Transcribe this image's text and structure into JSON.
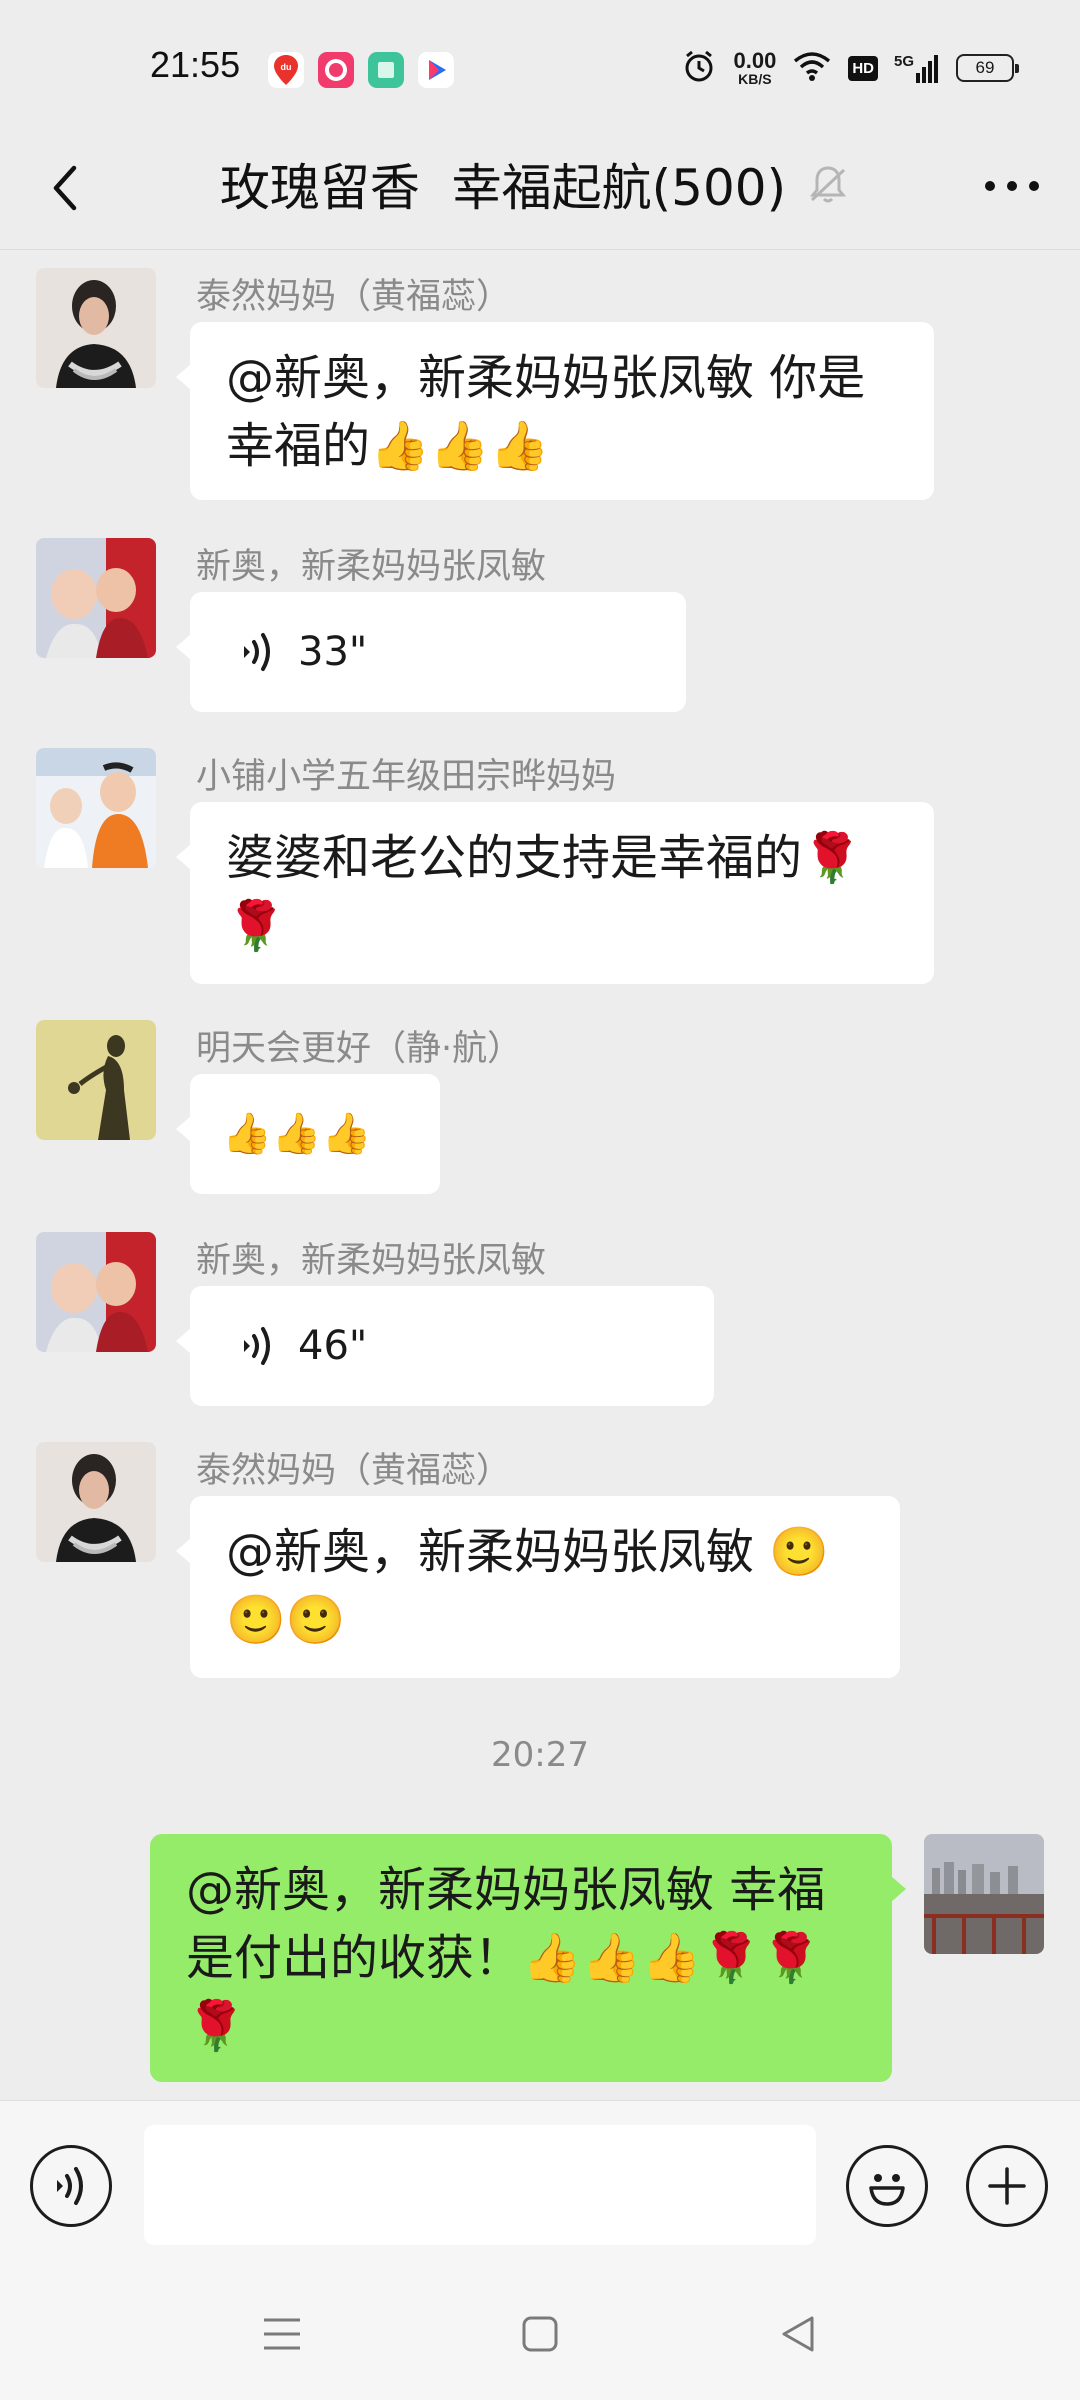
{
  "status": {
    "time": "21:55",
    "net_speed_value": "0.00",
    "net_speed_unit": "KB/S",
    "hd": "HD",
    "network": "5G",
    "battery": "69"
  },
  "header": {
    "title": "玫瑰留香  幸福起航(500)"
  },
  "messages": [
    {
      "sender": "泰然妈妈（黄福蕊）",
      "text": "@新奥，新柔妈妈张凤敏  你是幸福的👍👍👍"
    },
    {
      "sender": "新奥，新柔妈妈张凤敏",
      "duration": "33\""
    },
    {
      "sender": "小铺小学五年级田宗晔妈妈",
      "text": "婆婆和老公的支持是幸福的🌹🌹"
    },
    {
      "sender": "明天会更好（静·航）",
      "text": "👍👍👍"
    },
    {
      "sender": "新奥，新柔妈妈张凤敏",
      "duration": "46\""
    },
    {
      "sender": "泰然妈妈（黄福蕊）",
      "text": "@新奥，新柔妈妈张凤敏 🙂🙂🙂"
    }
  ],
  "timestamp": "20:27",
  "my_message": {
    "text": "@新奥，新柔妈妈张凤敏  幸福是付出的收获！👍👍👍🌹🌹🌹"
  },
  "input": {
    "placeholder": ""
  },
  "colors": {
    "background": "#ededed",
    "bubble_other": "#ffffff",
    "bubble_mine": "#95ec69",
    "sender_name": "#8a8a8a"
  }
}
